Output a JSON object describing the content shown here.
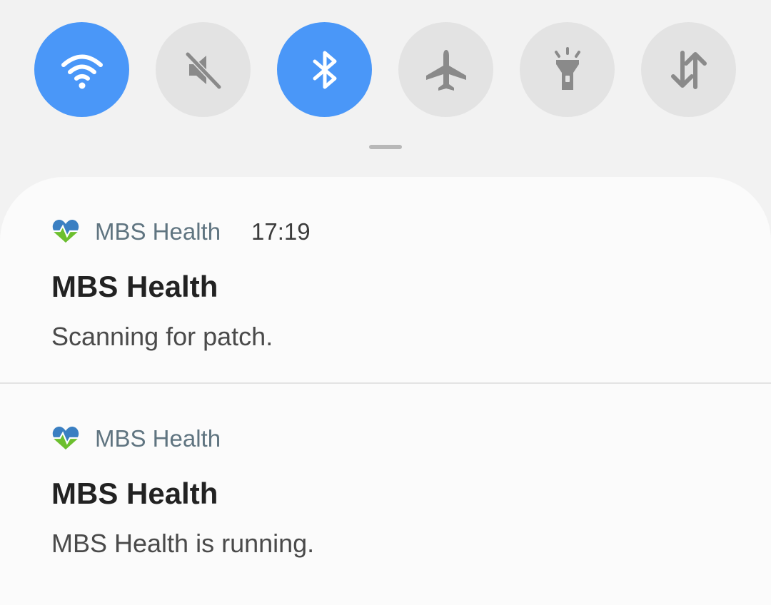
{
  "quick_settings": {
    "tiles": [
      {
        "icon": "wifi-icon",
        "active": true
      },
      {
        "icon": "sound-mute-icon",
        "active": false
      },
      {
        "icon": "bluetooth-icon",
        "active": true
      },
      {
        "icon": "airplane-mode-icon",
        "active": false
      },
      {
        "icon": "flashlight-icon",
        "active": false
      },
      {
        "icon": "mobile-data-icon",
        "active": false
      }
    ],
    "active_color": "#4a97f8",
    "inactive_color": "#e3e3e3",
    "inactive_icon_color": "#8a8a8a"
  },
  "notifications": [
    {
      "app_name": "MBS Health",
      "time": "17:19",
      "title": "MBS Health",
      "text": "Scanning for patch.",
      "icon": "heart-health-icon"
    },
    {
      "app_name": "MBS Health",
      "title": "MBS Health",
      "text": "MBS Health is running.",
      "icon": "heart-health-icon"
    }
  ]
}
